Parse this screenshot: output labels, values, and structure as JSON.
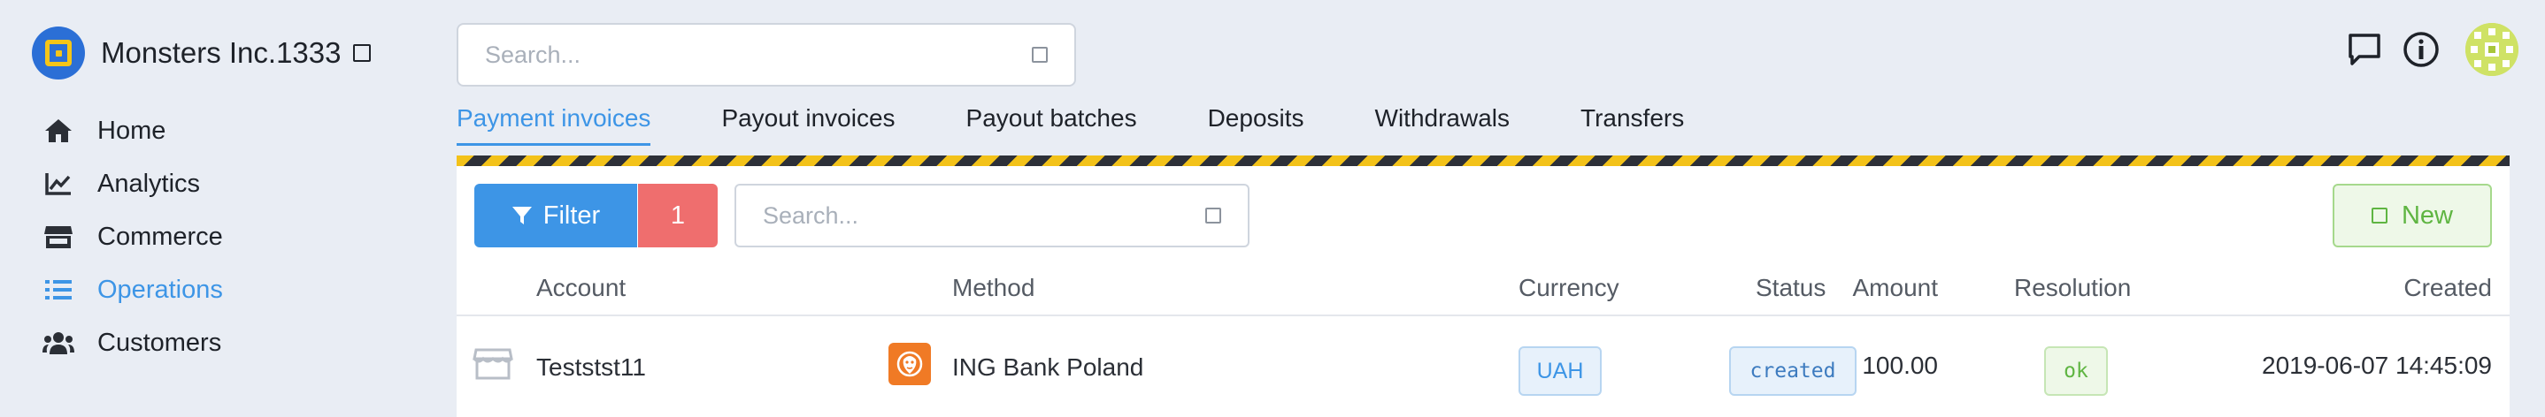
{
  "brand": {
    "name": "Monsters Inc.1333"
  },
  "nav": {
    "items": [
      {
        "label": "Home",
        "icon": "home-icon"
      },
      {
        "label": "Analytics",
        "icon": "chart-line-icon"
      },
      {
        "label": "Commerce",
        "icon": "store-icon"
      },
      {
        "label": "Operations",
        "icon": "list-icon",
        "active": true
      },
      {
        "label": "Customers",
        "icon": "users-icon"
      }
    ]
  },
  "search": {
    "placeholder": "Search..."
  },
  "tabs": [
    {
      "label": "Payment invoices",
      "active": true
    },
    {
      "label": "Payout invoices"
    },
    {
      "label": "Payout batches"
    },
    {
      "label": "Deposits"
    },
    {
      "label": "Withdrawals"
    },
    {
      "label": "Transfers"
    }
  ],
  "toolbar": {
    "filter_label": "Filter",
    "filter_count": "1",
    "search_placeholder": "Search...",
    "new_label": "New"
  },
  "table": {
    "headers": {
      "account": "Account",
      "method": "Method",
      "amount": "Amount",
      "currency": "Currency",
      "status": "Status",
      "resolution": "Resolution",
      "created": "Created"
    },
    "rows": [
      {
        "account": "Teststst11",
        "method": "ING Bank Poland",
        "amount": "100.00",
        "currency": "UAH",
        "status": "created",
        "resolution": "ok",
        "created": "2019-06-07 14:45:09"
      }
    ]
  },
  "colors": {
    "accent": "#3d95e6",
    "danger": "#ef6e6e",
    "success": "#5fb542",
    "stripe_yellow": "#f3c219",
    "stripe_dark": "#2d3038"
  }
}
